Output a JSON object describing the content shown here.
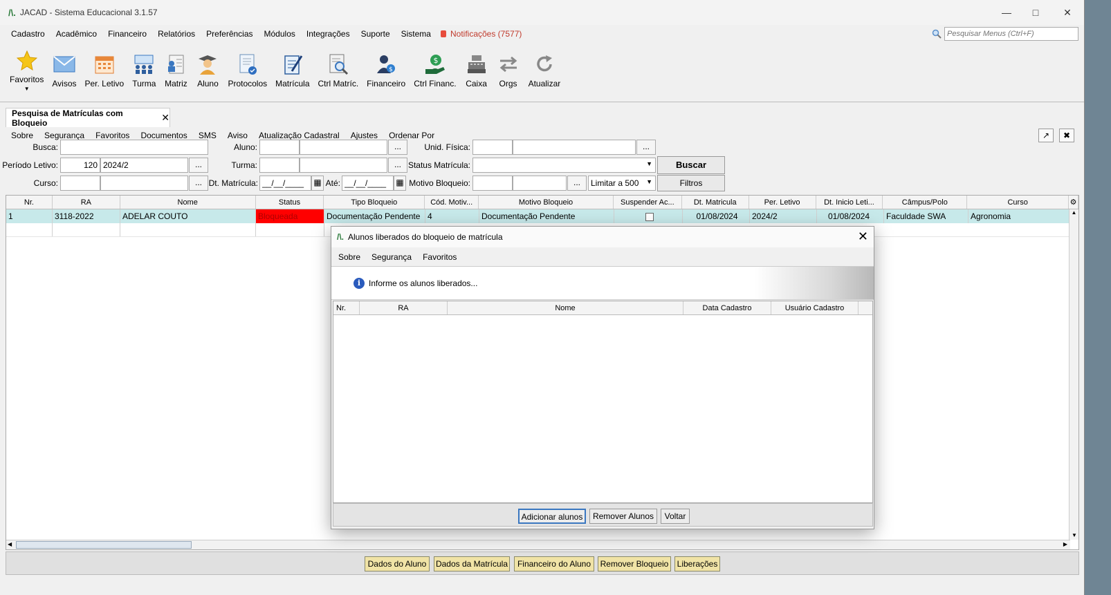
{
  "window": {
    "logo": "/\\.",
    "title": "JACAD - Sistema Educacional 3.1.57"
  },
  "menu": {
    "items": [
      "Cadastro",
      "Acadêmico",
      "Financeiro",
      "Relatórios",
      "Preferências",
      "Módulos",
      "Integrações",
      "Suporte",
      "Sistema"
    ],
    "notifications": "Notificações (7577)",
    "search_placeholder": "Pesquisar Menus (Ctrl+F)"
  },
  "toolbar": [
    {
      "label": "Favoritos",
      "icon": "star-icon"
    },
    {
      "label": "Avisos",
      "icon": "envelope-icon"
    },
    {
      "label": "Per. Letivo",
      "icon": "calendar-icon"
    },
    {
      "label": "Turma",
      "icon": "class-group-icon"
    },
    {
      "label": "Matriz",
      "icon": "matrix-icon"
    },
    {
      "label": "Aluno",
      "icon": "student-icon"
    },
    {
      "label": "Protocolos",
      "icon": "protocol-document-icon"
    },
    {
      "label": "Matrícula",
      "icon": "enrollment-form-icon"
    },
    {
      "label": "Ctrl Matríc.",
      "icon": "enrollment-search-icon"
    },
    {
      "label": "Financeiro",
      "icon": "financial-person-icon"
    },
    {
      "label": "Ctrl Financ.",
      "icon": "money-hand-icon"
    },
    {
      "label": "Caixa",
      "icon": "cash-register-icon"
    },
    {
      "label": "Orgs",
      "icon": "swap-arrows-icon"
    },
    {
      "label": "Atualizar",
      "icon": "refresh-icon"
    }
  ],
  "tab": {
    "label": "Pesquisa de Matrículas com Bloqueio",
    "close": "✕"
  },
  "submenu": [
    "Sobre",
    "Segurança",
    "Favoritos",
    "Documentos",
    "SMS",
    "Aviso",
    "Atualização Cadastral",
    "Ajustes",
    "Ordenar Por"
  ],
  "filters": {
    "busca_label": "Busca:",
    "periodo_label": "Período Letivo:",
    "periodo_code": "120",
    "periodo_value": "2024/2",
    "curso_label": "Curso:",
    "aluno_label": "Aluno:",
    "turma_label": "Turma:",
    "dt_matricula_label": "Dt. Matrícula:",
    "dt_placeholder": "__/__/____",
    "ate_label": "Até:",
    "unid_label": "Unid. Física:",
    "status_label": "Status Matrícula:",
    "motivo_label": "Motivo Bloqueio:",
    "limit_value": "Limitar a 500",
    "buscar_button": "Buscar",
    "filtros_button": "Filtros",
    "dots": "..."
  },
  "grid": {
    "headers": [
      "Nr.",
      "RA",
      "Nome",
      "Status",
      "Tipo Bloqueio",
      "Cód. Motiv...",
      "Motivo Bloqueio",
      "Suspender Ac...",
      "Dt. Matricula",
      "Per. Letivo",
      "Dt. Inicio Leti...",
      "Câmpus/Polo",
      "Curso"
    ],
    "rows": [
      {
        "nr": "1",
        "ra": "3118-2022",
        "nome": "ADELAR COUTO",
        "status": "Bloqueada",
        "tipo": "Documentação Pendente",
        "cod": "4",
        "motivo": "Documentação Pendente",
        "dt_matricula": "01/08/2024",
        "per_letivo": "2024/2",
        "dt_inicio": "01/08/2024",
        "campus": "Faculdade SWA",
        "curso": "Agronomia"
      }
    ],
    "status_color": "#ff0000"
  },
  "bottom_buttons": [
    "Dados do Aluno",
    "Dados da Matrícula",
    "Financeiro do Aluno",
    "Remover Bloqueio",
    "Liberações"
  ],
  "dialog": {
    "title": "Alunos liberados do bloqueio de matrícula",
    "menu": [
      "Sobre",
      "Segurança",
      "Favoritos"
    ],
    "info": "Informe os alunos liberados...",
    "headers": [
      "Nr.",
      "RA",
      "Nome",
      "Data Cadastro",
      "Usuário Cadastro"
    ],
    "buttons": [
      "Adicionar alunos",
      "Remover Alunos",
      "Voltar"
    ]
  }
}
